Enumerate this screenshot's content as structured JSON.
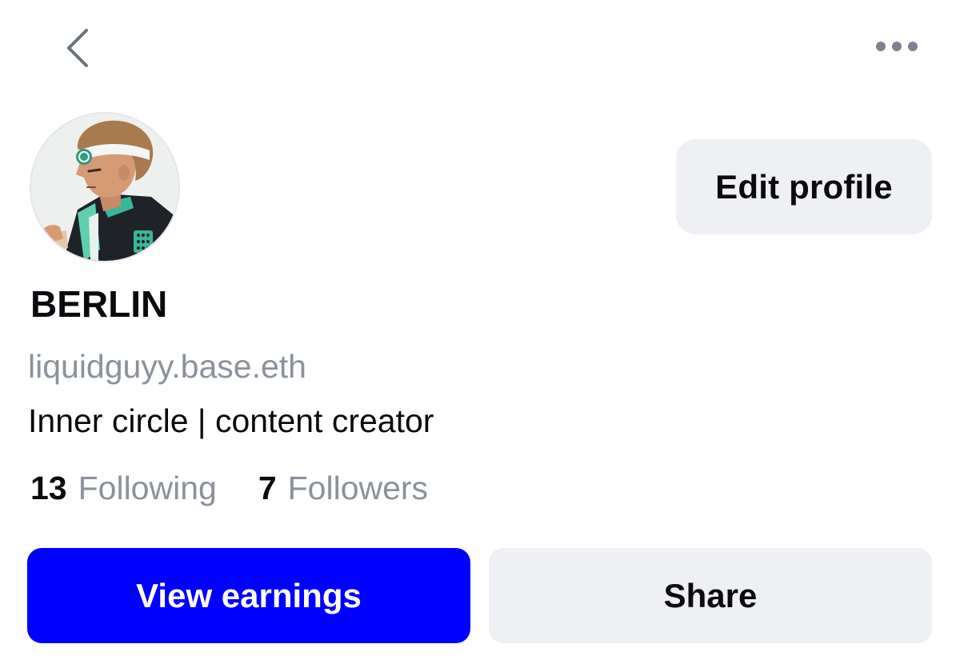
{
  "header": {
    "back_icon": "chevron-left-icon",
    "more_icon": "more-horizontal-icon"
  },
  "profile": {
    "avatar": "avatar-illustration",
    "display_name": "BERLIN",
    "handle": "liquidguyy.base.eth",
    "bio": "Inner circle | content creator",
    "edit_label": "Edit profile"
  },
  "stats": {
    "following_count": "13",
    "following_label": "Following",
    "followers_count": "7",
    "followers_label": "Followers"
  },
  "actions": {
    "earnings_label": "View earnings",
    "share_label": "Share"
  },
  "colors": {
    "primary": "#0000ff",
    "secondary_bg": "#eef0f3",
    "muted_text": "#8c929b",
    "text": "#0b0b0f"
  }
}
